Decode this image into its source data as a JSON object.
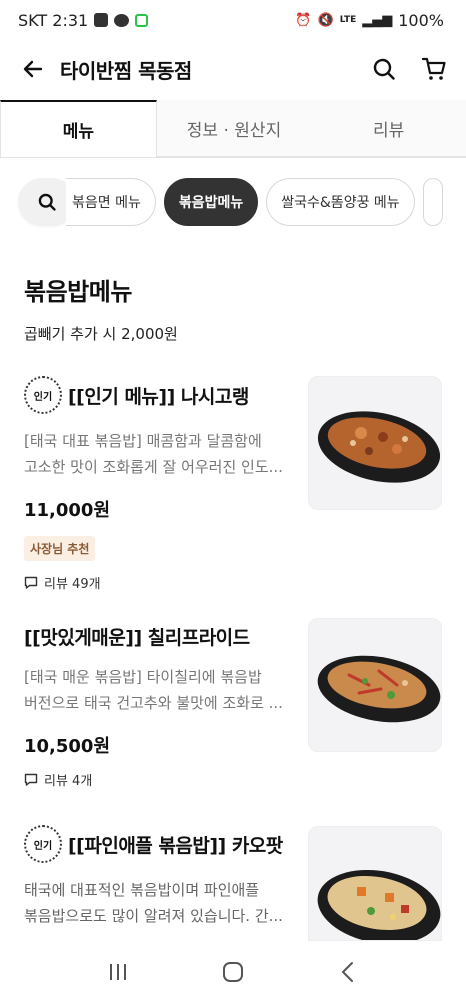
{
  "status_bar": {
    "carrier_time": "SKT 2:31",
    "battery": "100%",
    "network": "LTE"
  },
  "header": {
    "title": "타이반찜 목동점"
  },
  "tabs": [
    {
      "label": "메뉴",
      "active": true
    },
    {
      "label": "정보 · 원산지",
      "active": false
    },
    {
      "label": "리뷰",
      "active": false
    }
  ],
  "category_chips": [
    {
      "label": "볶음면 메뉴",
      "active": false
    },
    {
      "label": "볶음밥메뉴",
      "active": true
    },
    {
      "label": "쌀국수&똠양꿍 메뉴",
      "active": false
    }
  ],
  "section": {
    "title": "볶음밥메뉴",
    "description": "곱빼기 추가 시 2,000원"
  },
  "menu_items": [
    {
      "popular_badge": "인기",
      "name": "[[인기 메뉴]] 나시고랭",
      "desc_line1": "[태국 대표 볶음밥] 매콤함과 달콤함에",
      "desc_line2": "고소한 맛이 조화롭게 잘 어우러진 인도...",
      "price": "11,000원",
      "owner_badge": "사장님 추천",
      "review": "리뷰 49개"
    },
    {
      "name": "[[맛있게매운]] 칠리프라이드",
      "desc_line1": "[태국 매운 볶음밥] 타이칠리에 볶음밥",
      "desc_line2": "버전으로 태국 건고추와 불맛에 조화로 ...",
      "price": "10,500원",
      "review": "리뷰 4개"
    },
    {
      "popular_badge": "인기",
      "name": "[[파인애플 볶음밥]] 카오팟",
      "desc_line1": "태국에 대표적인 볶음밥이며 파인애플",
      "desc_line2": "볶음밥으로도 많이 알려져 있습니다. 간..."
    }
  ],
  "colors": {
    "active_chip": "#333333",
    "owner_badge_bg": "#fbefe4",
    "owner_badge_text": "#8a5a34"
  }
}
